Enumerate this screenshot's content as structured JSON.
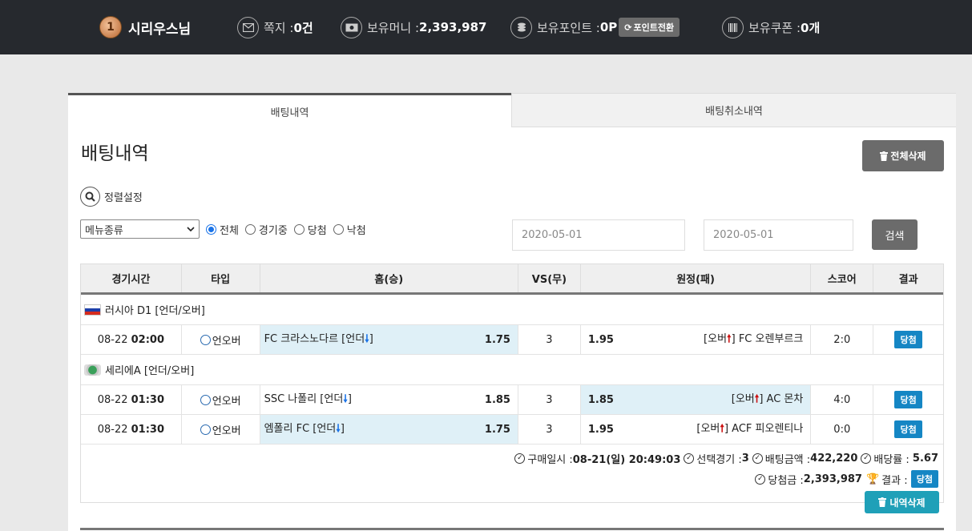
{
  "user": {
    "name": "시리우스님",
    "level_badge": "1"
  },
  "topbar": {
    "messages": {
      "label": "쪽지 :",
      "value": "0건"
    },
    "money": {
      "label": "보유머니 :",
      "value": "2,393,987"
    },
    "points": {
      "label": "보유포인트 :",
      "value": "0P",
      "convert_button": "포인트전환"
    },
    "coupons": {
      "label": "보유쿠폰 :",
      "value": "0개"
    }
  },
  "tabs": [
    {
      "label": "배팅내역",
      "active": true
    },
    {
      "label": "배팅취소내역",
      "active": false
    }
  ],
  "page": {
    "title": "배팅내역",
    "delete_all_button": "전체삭제",
    "sort_label": "정렬설정"
  },
  "filters": {
    "menu_select": "메뉴종류",
    "radios": [
      {
        "label": "전체",
        "checked": true
      },
      {
        "label": "경기중",
        "checked": false
      },
      {
        "label": "당첨",
        "checked": false
      },
      {
        "label": "낙첨",
        "checked": false
      }
    ],
    "date_from_placeholder": "2020-05-01",
    "date_to_placeholder": "2020-05-01",
    "search_button": "검색"
  },
  "table": {
    "headers": [
      "경기시간",
      "타입",
      "홈(승)",
      "VS(무)",
      "원정(패)",
      "스코어",
      "결과"
    ],
    "groups": [
      {
        "league": "러시아 D1 [언더/오버]",
        "rows": [
          {
            "date": "08-22",
            "time": "02:00",
            "type": "언오버",
            "home": "FC 크라스노다르 [언더",
            "home_odds": "1.75",
            "vs": "3",
            "away_odds": "1.95",
            "away": "[오버",
            "away_team": "] FC 오렌부르크",
            "score": "2:0",
            "result": "당첨"
          }
        ]
      },
      {
        "league": "세리에A [언더/오버]",
        "rows": [
          {
            "date": "08-22",
            "time": "01:30",
            "type": "언오버",
            "home": "SSC 나폴리 [언더",
            "home_odds": "1.85",
            "vs": "3",
            "away_odds": "1.85",
            "away": "[오버",
            "away_team": "] AC 몬차",
            "score": "4:0",
            "result": "당첨"
          },
          {
            "date": "08-22",
            "time": "01:30",
            "type": "언오버",
            "home": "엠폴리 FC [언더",
            "home_odds": "1.75",
            "vs": "3",
            "away_odds": "1.95",
            "away": "[오버",
            "away_team": "] ACF 피오렌티나",
            "score": "0:0",
            "result": "당첨"
          }
        ]
      }
    ]
  },
  "summary": {
    "purchase_label": "구매일시 :",
    "purchase_value": "08-21(일) 20:49:03",
    "games_label": "선택경기 :",
    "games_value": "3",
    "amount_label": "배팅금액 :",
    "amount_value": "422,220",
    "rate_label": "배당률 :",
    "rate_value": "5.67",
    "win_label": "당첨금 :",
    "win_value": "2,393,987",
    "result_label": "결과 :",
    "result_value": "당첨",
    "delete_button": "내역삭제"
  },
  "colors": {
    "topbar": "#26292e",
    "selected_cell": "#dff0f7",
    "badge": "#1586c4",
    "delete_history": "#1fa0b8"
  }
}
